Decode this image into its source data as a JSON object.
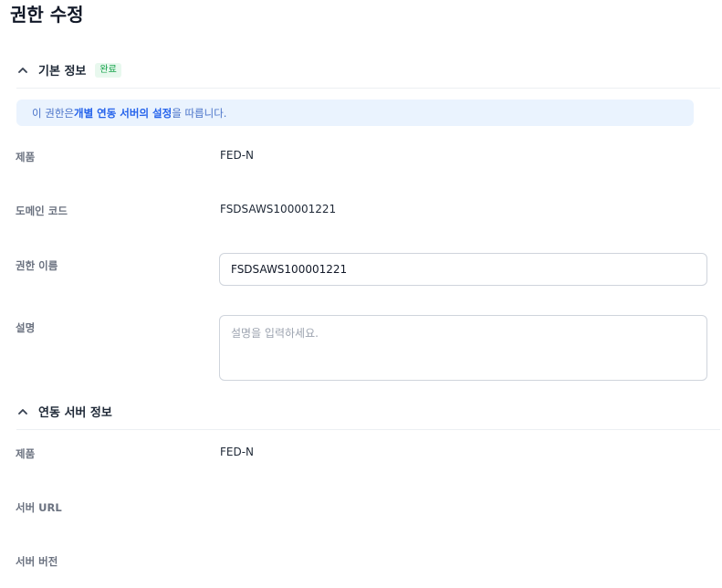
{
  "page": {
    "title": "권한 수정"
  },
  "basic_section": {
    "title": "기본 정보",
    "badge": "완료",
    "info_prefix": "이 권한은 ",
    "info_bold": "개별 연동 서버의 설정",
    "info_suffix": "을 따릅니다.",
    "fields": {
      "product_label": "제품",
      "product_value": "FED-N",
      "domain_code_label": "도메인 코드",
      "domain_code_value": "FSDSAWS100001221",
      "permission_name_label": "권한 이름",
      "permission_name_value": "FSDSAWS100001221",
      "description_label": "설명",
      "description_placeholder": "설명을 입력하세요."
    }
  },
  "server_section": {
    "title": "연동 서버 정보",
    "fields": {
      "product_label": "제품",
      "product_value": "FED-N",
      "server_url_label": "서버 URL",
      "server_version_label": "서버 버전"
    }
  },
  "colors": {
    "accent": "#2563eb",
    "banner_bg": "#eaf3fe",
    "badge_fg": "#16a34a",
    "badge_bg": "#e8f8ee"
  }
}
